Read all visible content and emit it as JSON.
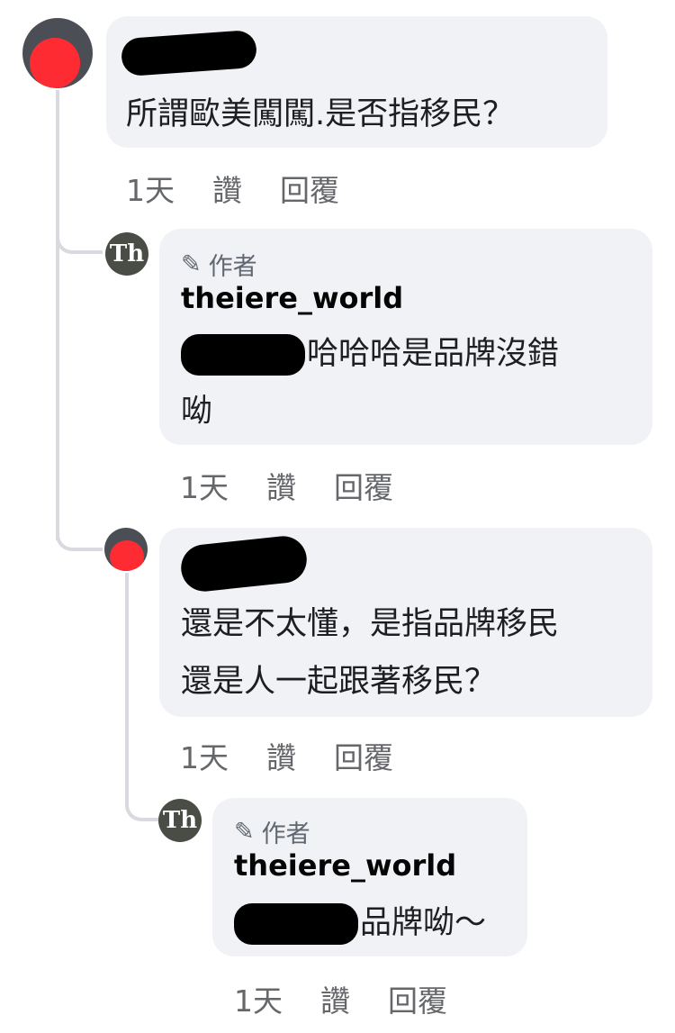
{
  "comments": [
    {
      "text": "所謂歐美闖闖.是否指移民？",
      "time": "1天",
      "like": "讚",
      "reply": "回覆"
    },
    {
      "author_badge": "作者",
      "author": "theiere_world",
      "line1": "哈哈哈是品牌沒錯",
      "line2": "呦",
      "avatar_text": "Th",
      "time": "1天",
      "like": "讚",
      "reply": "回覆"
    },
    {
      "line1": "還是不太懂，是指品牌移民",
      "line2": "還是人一起跟著移民？",
      "time": "1天",
      "like": "讚",
      "reply": "回覆"
    },
    {
      "author_badge": "作者",
      "author": "theiere_world",
      "line1": "品牌呦～",
      "avatar_text": "Th",
      "time": "1天",
      "like": "讚",
      "reply": "回覆"
    }
  ],
  "colors": {
    "bubble": "#f0f2f5",
    "meta_text": "#65676b",
    "thread_line": "#d8dadf",
    "avatar_red": "#ff2b33",
    "author_avatar": "#4a4d46"
  }
}
